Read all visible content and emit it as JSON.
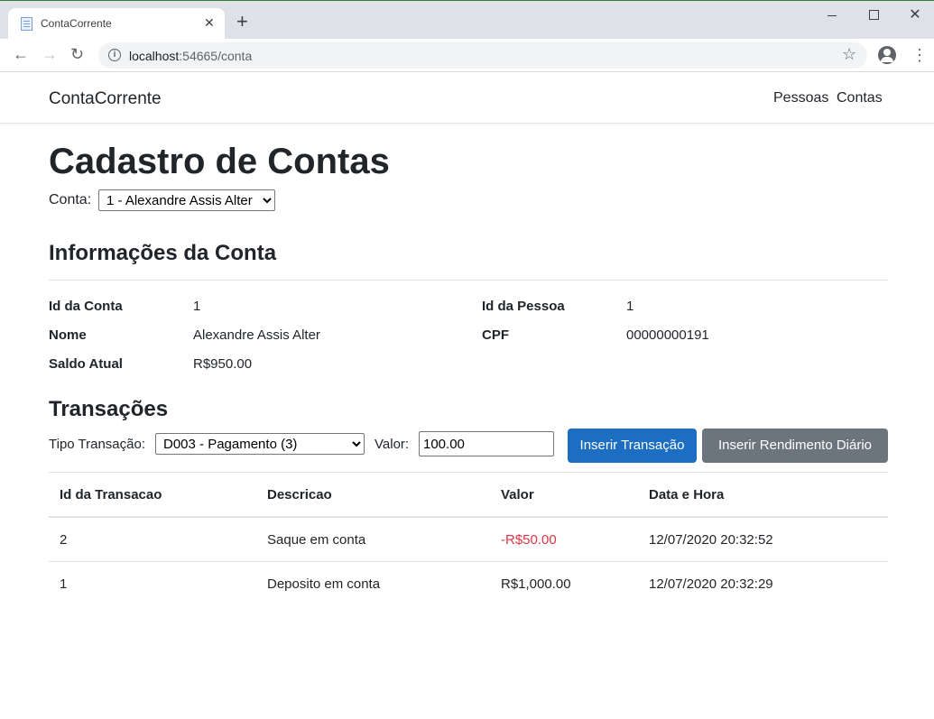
{
  "browser": {
    "tab_title": "ContaCorrente",
    "url_host": "localhost",
    "url_port": ":54665",
    "url_path": "/conta",
    "new_tab": "+",
    "close_tab": "✕"
  },
  "navbar": {
    "brand": "ContaCorrente",
    "links": [
      "Pessoas",
      "Contas"
    ]
  },
  "page": {
    "title": "Cadastro de Contas",
    "conta_label": "Conta:",
    "conta_selected": "1 - Alexandre Assis Alter"
  },
  "info": {
    "title": "Informações da Conta",
    "id_conta_label": "Id da Conta",
    "id_conta": "1",
    "nome_label": "Nome",
    "nome": "Alexandre Assis Alter",
    "saldo_label": "Saldo Atual",
    "saldo": "R$950.00",
    "id_pessoa_label": "Id da Pessoa",
    "id_pessoa": "1",
    "cpf_label": "CPF",
    "cpf": "00000000191"
  },
  "transacoes": {
    "title": "Transações",
    "tipo_label": "Tipo Transação:",
    "tipo_selected": "D003 - Pagamento (3)",
    "valor_label": "Valor:",
    "valor_value": "100.00",
    "btn_inserir": "Inserir Transação",
    "btn_rendimento": "Inserir Rendimento Diário",
    "columns": [
      "Id da Transacao",
      "Descricao",
      "Valor",
      "Data e Hora"
    ],
    "rows": [
      {
        "id": "2",
        "descricao": "Saque em conta",
        "valor": "-R$50.00",
        "data": "12/07/2020 20:32:52"
      },
      {
        "id": "1",
        "descricao": "Deposito em conta",
        "valor": "R$1,000.00",
        "data": "12/07/2020 20:32:29"
      }
    ]
  },
  "colors": {
    "primary": "#1b6ec2",
    "secondary": "#6c757d",
    "negative": "#dc3545"
  }
}
